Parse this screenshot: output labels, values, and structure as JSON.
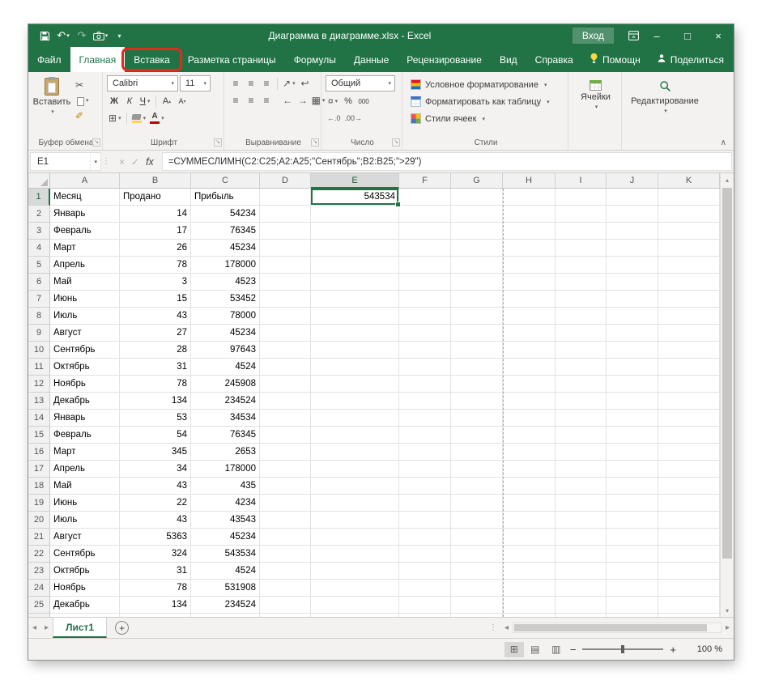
{
  "theme": {
    "accent_green": "#217346",
    "annotation_red": "#e02b20",
    "fill_yellow": "#ffd34d",
    "font_color_red": "#c00000"
  },
  "titlebar": {
    "title": "Диаграмма в диаграмме.xlsx  -  Excel",
    "signin": "Вход"
  },
  "menu": {
    "tabs": [
      {
        "label": "Файл"
      },
      {
        "label": "Главная",
        "active": true
      },
      {
        "label": "Вставка",
        "annotated": true
      },
      {
        "label": "Разметка страницы"
      },
      {
        "label": "Формулы"
      },
      {
        "label": "Данные"
      },
      {
        "label": "Рецензирование"
      },
      {
        "label": "Вид"
      },
      {
        "label": "Справка"
      }
    ],
    "helper": "Помощн",
    "share": "Поделиться"
  },
  "ribbon": {
    "clipboard": {
      "label": "Буфер обмена",
      "paste": "Вставить"
    },
    "font": {
      "label": "Шрифт",
      "name": "Calibri",
      "size": "11",
      "bold": "Ж",
      "italic": "К",
      "underline": "Ч",
      "grow": "А",
      "shrink": "А"
    },
    "alignment": {
      "label": "Выравнивание"
    },
    "number": {
      "label": "Число",
      "format": "Общий",
      "percent": "%",
      "comma": "000"
    },
    "styles": {
      "label": "Стили",
      "conditional": "Условное форматирование",
      "table": "Форматировать как таблицу",
      "cellstyles": "Стили ячеек"
    },
    "cells": {
      "label": "Ячейки"
    },
    "editing": {
      "label": "Редактирование"
    }
  },
  "formula": {
    "name_box": "E1",
    "fx": "fx",
    "formula": "=СУММЕСЛИМН(C2:C25;A2:A25;\"Сентябрь\";B2:B25;\">29\")"
  },
  "grid": {
    "columns": [
      "A",
      "B",
      "C",
      "D",
      "E",
      "F",
      "G",
      "H",
      "I",
      "J",
      "K"
    ],
    "selected": {
      "col": "E",
      "row": "1",
      "value": "543534"
    },
    "rows": [
      {
        "n": "1",
        "a": "Месяц",
        "b": "Продано",
        "c": "Прибыль",
        "e": "543534"
      },
      {
        "n": "2",
        "a": "Январь",
        "b": "14",
        "c": "54234"
      },
      {
        "n": "3",
        "a": "Февраль",
        "b": "17",
        "c": "76345"
      },
      {
        "n": "4",
        "a": "Март",
        "b": "26",
        "c": "45234"
      },
      {
        "n": "5",
        "a": "Апрель",
        "b": "78",
        "c": "178000"
      },
      {
        "n": "6",
        "a": "Май",
        "b": "3",
        "c": "4523"
      },
      {
        "n": "7",
        "a": "Июнь",
        "b": "15",
        "c": "53452"
      },
      {
        "n": "8",
        "a": "Июль",
        "b": "43",
        "c": "78000"
      },
      {
        "n": "9",
        "a": "Август",
        "b": "27",
        "c": "45234"
      },
      {
        "n": "10",
        "a": "Сентябрь",
        "b": "28",
        "c": "97643"
      },
      {
        "n": "11",
        "a": "Октябрь",
        "b": "31",
        "c": "4524"
      },
      {
        "n": "12",
        "a": "Ноябрь",
        "b": "78",
        "c": "245908"
      },
      {
        "n": "13",
        "a": "Декабрь",
        "b": "134",
        "c": "234524"
      },
      {
        "n": "14",
        "a": "Январь",
        "b": "53",
        "c": "34534"
      },
      {
        "n": "15",
        "a": "Февраль",
        "b": "54",
        "c": "76345"
      },
      {
        "n": "16",
        "a": "Март",
        "b": "345",
        "c": "2653"
      },
      {
        "n": "17",
        "a": "Апрель",
        "b": "34",
        "c": "178000"
      },
      {
        "n": "18",
        "a": "Май",
        "b": "43",
        "c": "435"
      },
      {
        "n": "19",
        "a": "Июнь",
        "b": "22",
        "c": "4234"
      },
      {
        "n": "20",
        "a": "Июль",
        "b": "43",
        "c": "43543"
      },
      {
        "n": "21",
        "a": "Август",
        "b": "5363",
        "c": "45234"
      },
      {
        "n": "22",
        "a": "Сентябрь",
        "b": "324",
        "c": "543534"
      },
      {
        "n": "23",
        "a": "Октябрь",
        "b": "31",
        "c": "4524"
      },
      {
        "n": "24",
        "a": "Ноябрь",
        "b": "78",
        "c": "531908"
      },
      {
        "n": "25",
        "a": "Декабрь",
        "b": "134",
        "c": "234524"
      }
    ]
  },
  "sheetbar": {
    "sheet": "Лист1"
  },
  "statusbar": {
    "zoom": "100 %"
  }
}
